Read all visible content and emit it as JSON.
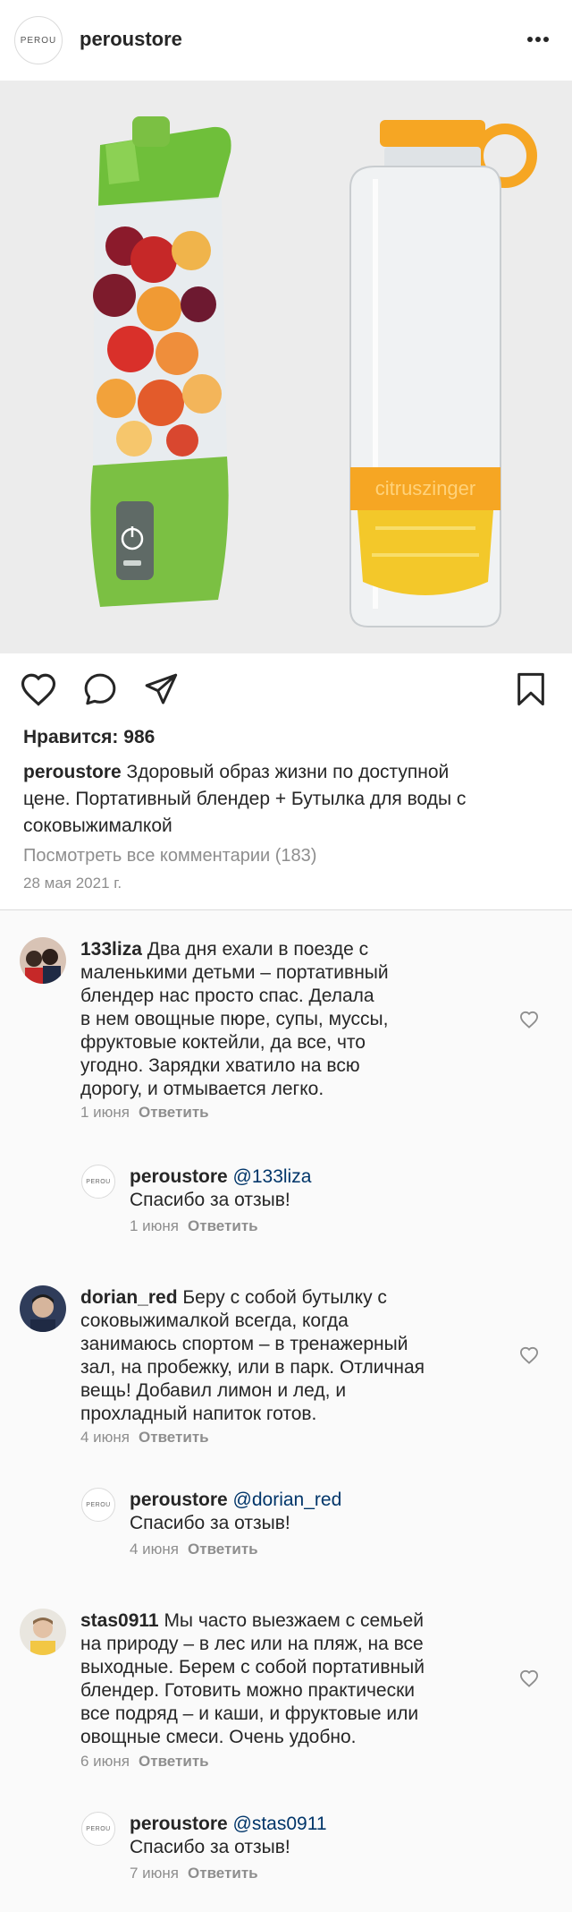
{
  "header": {
    "avatar_text": "PEROU",
    "username": "peroustore"
  },
  "post": {
    "image_alt_text": "citruszinger",
    "likes_label": "Нравится: 986",
    "caption_user": "peroustore",
    "caption_lines": [
      "Здоровый образ жизни по доступной",
      "цене. Портативный блендер + Бутылка для воды с",
      "соковыжималкой"
    ],
    "view_all_comments": "Посмотреть все комментарии (183)",
    "date": "28 мая 2021 г."
  },
  "blender_panel_text": "⏻",
  "comments": [
    {
      "user": "133liza",
      "lines": [
        "Два дня ехали в поезде с",
        "маленькими детьми – портативный",
        "блендер нас просто спас. Делала",
        "в нем овощные пюре, супы, муссы,",
        "фруктовые коктейли, да все, что",
        "угодно. Зарядки хватило на всю",
        "дорогу, и отмывается легко."
      ],
      "date": "1 июня",
      "reply_label": "Ответить",
      "reply": {
        "user": "peroustore",
        "avatar_text": "PEROU",
        "mention": "@133liza",
        "text": "Спасибо за отзыв!",
        "date": "1 июня",
        "reply_label": "Ответить"
      }
    },
    {
      "user": "dorian_red",
      "lines": [
        "Беру с собой бутылку с",
        "соковыжималкой всегда, когда",
        "занимаюсь спортом – в тренажерный",
        "зал, на пробежку, или в парк. Отличная",
        "вещь! Добавил лимон и лед, и",
        "прохладный напиток готов."
      ],
      "date": "4 июня",
      "reply_label": "Ответить",
      "reply": {
        "user": "peroustore",
        "avatar_text": "PEROU",
        "mention": "@dorian_red",
        "text": "Спасибо за отзыв!",
        "date": "4 июня",
        "reply_label": "Ответить"
      }
    },
    {
      "user": "stas0911",
      "lines": [
        "Мы часто выезжаем с семьей",
        "на природу – в лес или на пляж, на все",
        "выходные. Берем с собой портативный",
        "блендер. Готовить можно практически",
        "все подряд – и каши, и фруктовые или",
        "овощные смеси. Очень удобно."
      ],
      "date": "6 июня",
      "reply_label": "Ответить",
      "reply": {
        "user": "peroustore",
        "avatar_text": "PEROU",
        "mention": "@stas0911",
        "text": "Спасибо за отзыв!",
        "date": "7 июня",
        "reply_label": "Ответить"
      }
    }
  ],
  "icons": [
    "more-icon",
    "heart-icon",
    "comment-icon",
    "share-icon",
    "bookmark-icon",
    "heart-small-icon"
  ],
  "colors": {
    "text": "#262626",
    "muted": "#8e8e8e",
    "mention": "#003569",
    "blender_green": "#7bc043",
    "bottle_orange": "#f6a623"
  }
}
